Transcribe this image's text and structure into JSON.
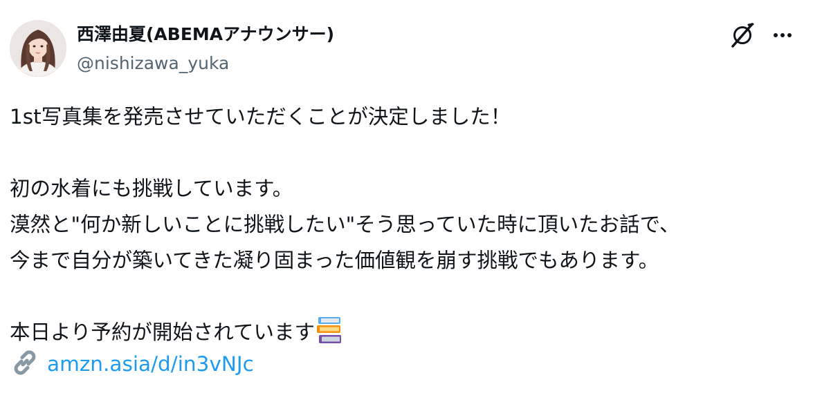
{
  "post": {
    "author": {
      "display_name": "西澤由夏(ABEMAアナウンサー)",
      "handle": "@nishizawa_yuka"
    },
    "text_lines": [
      "1st写真集を発売させていただくことが決定しました！",
      "",
      "初の水着にも挑戦しています。",
      "漠然と\"何か新しいことに挑戦したい\"そう思っていた時に頂いたお話で、",
      "今まで自分が築いてきた凝り固まった価値観を崩す挑戦でもあります。",
      "",
      "本日より予約が開始されています"
    ],
    "emoji": "books-emoji",
    "link": {
      "text": "amzn.asia/d/in3vNJc"
    }
  },
  "icons": {
    "grok": "grok-icon",
    "more": "more-icon",
    "link": "link-icon"
  },
  "colors": {
    "text": "#0f1419",
    "secondary": "#536471",
    "link": "#1d9bf0",
    "background": "#ffffff"
  }
}
